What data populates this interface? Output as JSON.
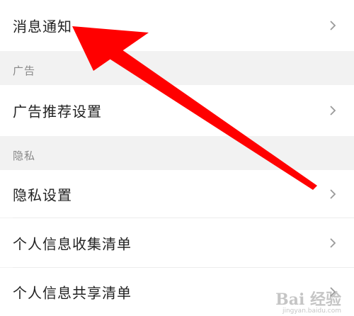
{
  "rows": [
    {
      "label": "消息通知"
    },
    {
      "label": "广告推荐设置"
    },
    {
      "label": "隐私设置"
    },
    {
      "label": "个人信息收集清单"
    },
    {
      "label": "个人信息共享清单"
    }
  ],
  "sections": {
    "ad": "广告",
    "privacy": "隐私"
  },
  "chevron_icon": "chevron-right-icon",
  "annotation_arrow_color": "#ff0000",
  "watermark": {
    "main": "Bai 经验",
    "sub": "jingyan.baidu.com"
  }
}
